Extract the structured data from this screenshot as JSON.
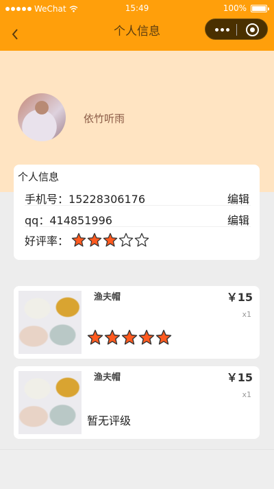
{
  "status_bar": {
    "carrier": "WeChat",
    "time": "15:49",
    "battery": "100%",
    "battery_level": 1.0
  },
  "nav": {
    "title": "个人信息"
  },
  "profile": {
    "username": "依竹听雨"
  },
  "info": {
    "section_title": "个人信息",
    "phone_label": "手机号：",
    "phone_value": "15228306176",
    "qq_label": "qq：",
    "qq_value": "414851996",
    "edit_label": "编辑",
    "rating_label": "好评率：",
    "rating_value": 3,
    "rating_max": 5
  },
  "orders": [
    {
      "name": "渔夫帽",
      "price": "￥15",
      "qty": "x1",
      "rating": 5,
      "rating_max": 5
    },
    {
      "name": "渔夫帽",
      "price": "￥15",
      "qty": "x1",
      "rating_text": "暂无评级"
    }
  ],
  "colors": {
    "accent": "#ff9f0b",
    "profile_bg": "#ffe4c2",
    "star_fill": "#ff5a1f",
    "star_stroke": "#333333"
  },
  "icons": {
    "back": "chevron-left-icon",
    "more": "more-dots-icon",
    "close": "target-icon",
    "wifi": "wifi-icon",
    "star": "star-icon"
  }
}
